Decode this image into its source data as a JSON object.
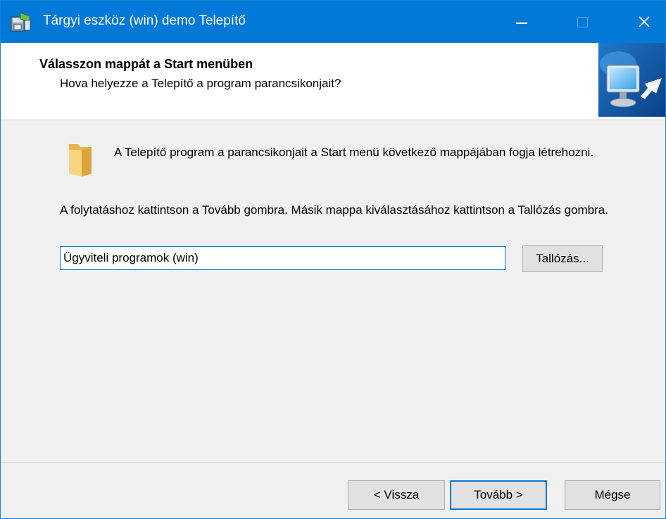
{
  "window": {
    "title": "Tárgyi eszköz (win) demo Telepítő"
  },
  "header": {
    "title": "Válasszon mappát a Start menüben",
    "subtitle": "Hova helyezze a Telepítő a program parancsikonjait?"
  },
  "body": {
    "info_text": "A Telepítő program a parancsikonjait a Start menü következő mappájában fogja létrehozni.",
    "instruction_text": "A folytatáshoz kattintson a Tovább gombra. Másik mappa kiválasztásához kattintson a Tallózás gombra.",
    "folder_value": "Ügyviteli programok (win)",
    "browse_label": "Tallózás..."
  },
  "footer": {
    "back_label": "< Vissza",
    "next_label": "Tovább >",
    "cancel_label": "Mégse"
  },
  "icons": {
    "app": "installer-icon",
    "header": "computer-shortcut-icon",
    "folder": "folder-icon"
  },
  "colors": {
    "titlebar": "#0078d7",
    "accent": "#0078d7",
    "dialog_bg": "#f0f0f0",
    "button_bg": "#e1e1e1"
  }
}
